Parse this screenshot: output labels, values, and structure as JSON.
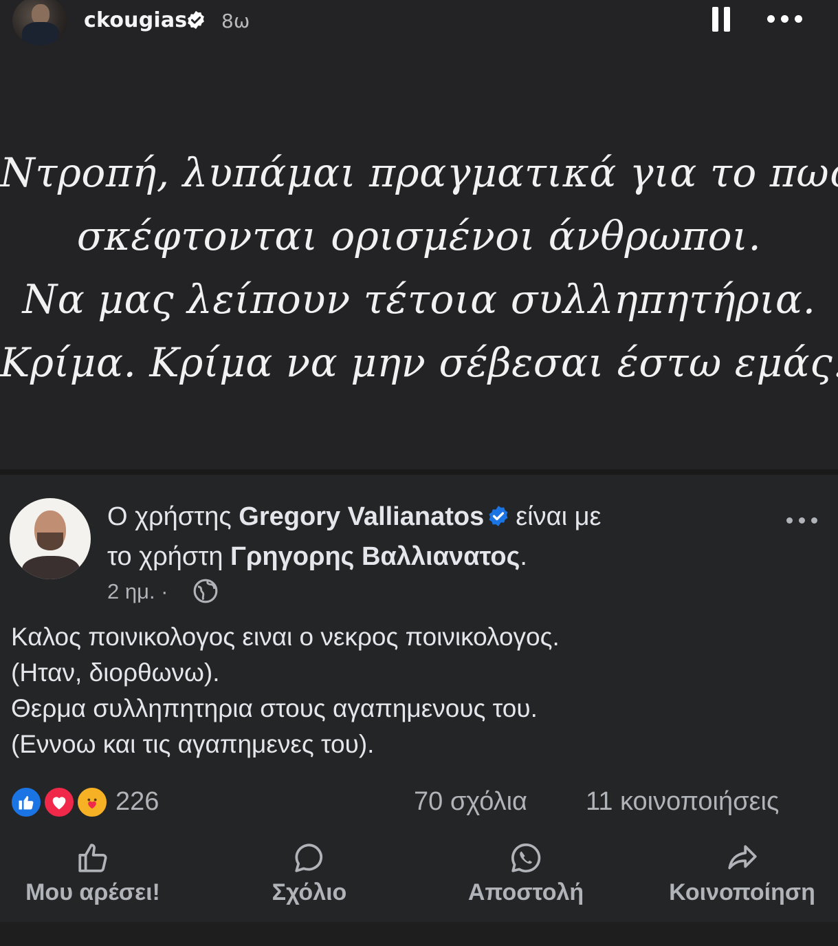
{
  "story": {
    "username": "ckougias",
    "time_ago": "8ω",
    "quote_lines": [
      "Ντροπή, λυπάμαι πραγματικά για το πως",
      "σκέφτονται ορισμένοι άνθρωποι.",
      "Να μας λείπουν τέτοια συλληπητήρια.",
      "Κρίμα. Κρίμα να μην σέβεσαι έστω εμάς."
    ]
  },
  "post": {
    "header_prefix": "Ο χρήστης",
    "author": "Gregory Vallianatos",
    "header_mid": "είναι με",
    "header_mid2": "το χρήστη",
    "tagged": "Γρηγορης Βαλλιανατος",
    "header_end": ".",
    "meta_time": "2 ημ. ·",
    "body_lines": [
      "Καλος ποινικολογος ειναι ο νεκρος ποινικολογος.",
      "(Ηταν, διορθωνω).",
      "Θερμα συλληπητηρια στους αγαπημενους του.",
      "(Εννοω και τις αγαπημενες του)."
    ],
    "reaction_count": "226",
    "comments": "70 σχόλια",
    "shares": "11 κοινοποιήσεις",
    "actions": {
      "like": "Μου αρέσει!",
      "comment": "Σχόλιο",
      "send": "Αποστολή",
      "share": "Κοινοποίηση"
    }
  },
  "colors": {
    "story_bg": "#232325",
    "post_bg": "#242526",
    "verified": "#1b74e4",
    "secondary_text": "#b0b3b8"
  },
  "icons": [
    "verified-badge-icon",
    "pause-icon",
    "more-icon",
    "globe-icon",
    "like-reaction-icon",
    "love-reaction-icon",
    "care-reaction-icon",
    "thumbs-up-icon",
    "comment-bubble-icon",
    "whatsapp-icon",
    "share-arrow-icon"
  ]
}
